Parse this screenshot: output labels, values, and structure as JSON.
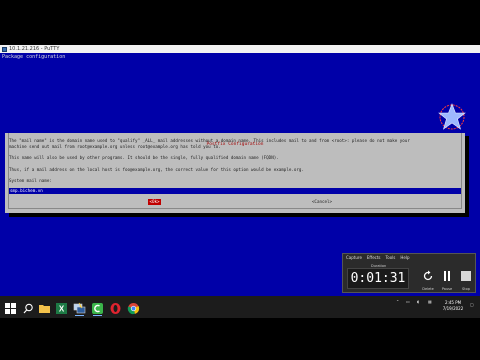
{
  "window": {
    "title": "10.1.21.216 - PuTTY"
  },
  "terminal": {
    "header": "Package configuration"
  },
  "logo": {
    "text": "DTD",
    "colors": {
      "star": "#9db8ff",
      "ring": "#ff3b3b"
    }
  },
  "dialog": {
    "title": "Postfix Configuration",
    "lines": [
      "The \"mail name\" is the domain name used to \"qualify\" _ALL_ mail addresses without a domain name. This includes mail to and from <root>: please do not make your",
      "machine send out mail from root@example.org unless root@example.org has told you to.",
      "This name will also be used by other programs. It should be the single, fully qualified domain name (FQDN).",
      "Thus, if a mail address on the local host is foo@example.org, the correct value for this option would be example.org.",
      "System mail name:"
    ],
    "input_value": "smp.bichem.vn",
    "ok_label": "<Ok>",
    "cancel_label": "<Cancel>"
  },
  "capture": {
    "menu": [
      "Capture",
      "Effects",
      "Tools",
      "Help"
    ],
    "duration_label": "Duration",
    "timer": "0:01:31",
    "delete_label": "Delete",
    "pause_label": "Pause",
    "stop_label": "Stop"
  },
  "taskbar": {
    "icons": [
      "windows-start-icon",
      "search-icon",
      "file-explorer-icon",
      "excel-icon",
      "putty-icon",
      "camtasia-icon",
      "opera-icon",
      "chrome-icon"
    ],
    "clock_time": "2:45 PM",
    "clock_date": "7/19/2022"
  }
}
